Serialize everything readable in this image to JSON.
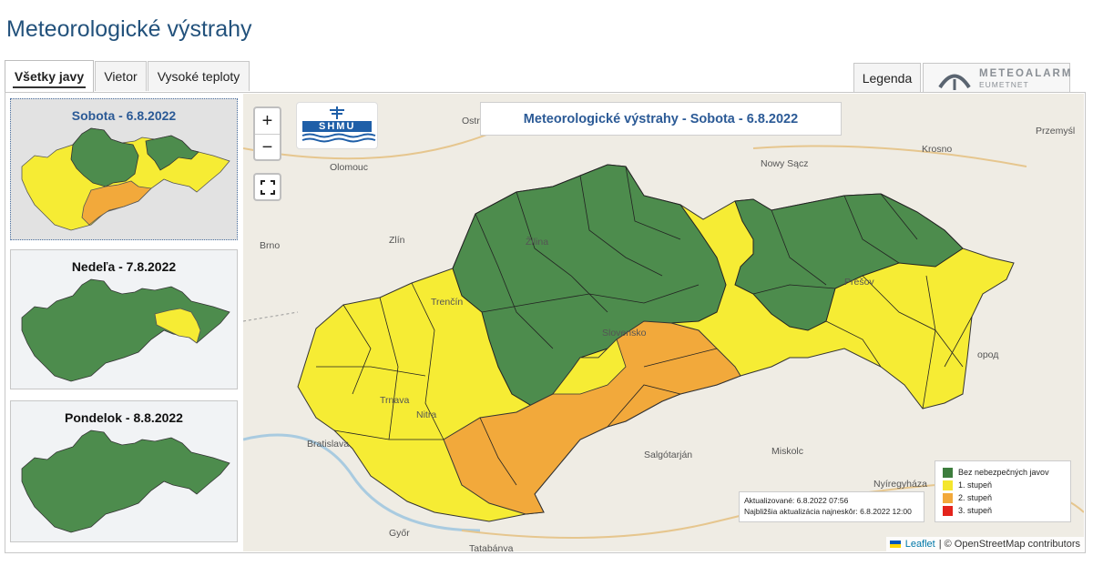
{
  "page": {
    "title": "Meteorologické výstrahy"
  },
  "tabs": [
    {
      "label": "Všetky javy",
      "active": true
    },
    {
      "label": "Vietor",
      "active": false
    },
    {
      "label": "Vysoké teploty",
      "active": false
    }
  ],
  "legend_tab": "Legenda",
  "meteoalarm": {
    "title": "METEOALARM",
    "sub": "EUMETNET"
  },
  "days": [
    {
      "label": "Sobota - 6.8.2022",
      "selected": true
    },
    {
      "label": "Nedeľa - 7.8.2022",
      "selected": false
    },
    {
      "label": "Pondelok - 8.8.2022",
      "selected": false
    }
  ],
  "map": {
    "title": "Meteorologické výstrahy - Sobota - 6.8.2022",
    "logo_text": "SHMU",
    "zoom_in": "+",
    "zoom_out": "−",
    "place_labels": [
      "Ostrava",
      "Olomouc",
      "Brno",
      "Zlín",
      "Žilina",
      "Trenčín",
      "Trnava",
      "Nitra",
      "Bratislava",
      "Győr",
      "Tatabánya",
      "Salgótarján",
      "Miskolc",
      "Nyíregyháza",
      "Krosno",
      "Przemyśl",
      "Nowy Sącz",
      "Prešov",
      "Slovensko",
      "ород"
    ]
  },
  "update_box": {
    "updated": "Aktualizované: 6.8.2022 07:56",
    "next": "Najbližšia aktualizácia najneskôr: 6.8.2022 12:00"
  },
  "legend": {
    "items": [
      {
        "label": "Bez nebezpečných javov",
        "color": "#3d7d3d"
      },
      {
        "label": "1. stupeň",
        "color": "#f4e62d"
      },
      {
        "label": "2. stupeň",
        "color": "#f2a93b"
      },
      {
        "label": "3. stupeň",
        "color": "#e4241c"
      }
    ]
  },
  "attribution": {
    "leaflet": "Leaflet",
    "rest": "| © OpenStreetMap contributors"
  },
  "colors": {
    "green": "#4d8c4d",
    "yellow": "#f6ec34",
    "orange": "#f2a93b",
    "accent": "#2b5a96"
  }
}
